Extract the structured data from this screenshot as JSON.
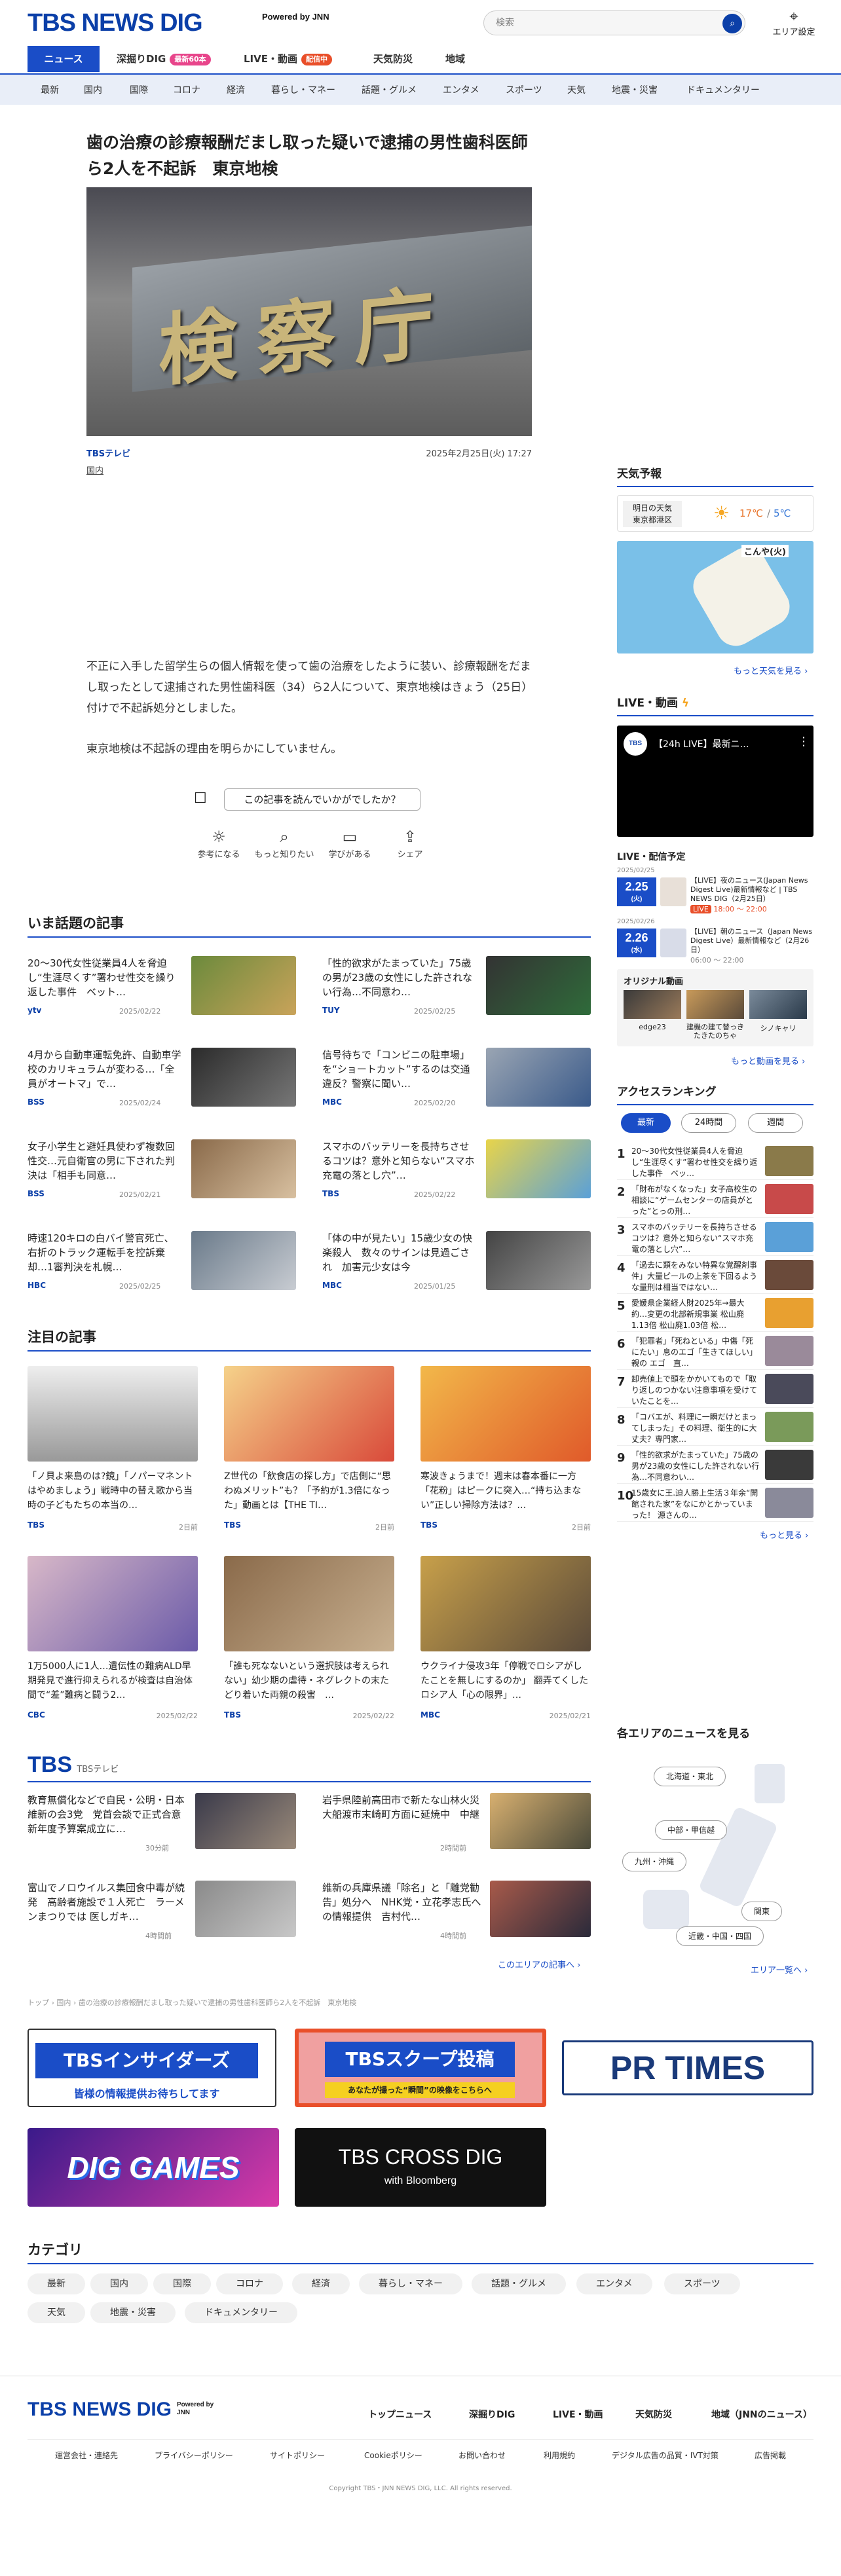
{
  "header": {
    "logo": "TBS NEWS DIG",
    "powered_by": "Powered by JNN",
    "search_placeholder": "検索",
    "area_label": "エリア設定"
  },
  "tabs": [
    {
      "label": "ニュース"
    },
    {
      "label": "深掘りDIG",
      "badge": "最新60本"
    },
    {
      "label": "LIVE・動画",
      "badge": "配信中"
    },
    {
      "label": "天気防災"
    },
    {
      "label": "地域"
    }
  ],
  "categories": [
    "最新",
    "国内",
    "国際",
    "コロナ",
    "経済",
    "暮らし・マネー",
    "話題・グルメ",
    "エンタメ",
    "スポーツ",
    "天気",
    "地震・災害",
    "ドキュメンタリー"
  ],
  "article": {
    "headline": "歯の治療の診療報酬だまし取った疑いで逮捕の男性歯科医師ら2人を不起訴　東京地検",
    "hero_text": "検察庁",
    "source": "TBSテレビ",
    "date": "2025年2月25日(火) 17:27",
    "tag": "国内",
    "body": [
      "不正に入手した留学生らの個人情報を使って歯の治療をしたように装い、診療報酬をだまし取ったとして逮捕された男性歯科医（34）ら2人について、東京地検はきょう（25日）付けで不起訴処分としました。",
      "東京地検は不起訴の理由を明らかにしていません。"
    ],
    "reaction_question": "この記事を読んでいかがでしたか？",
    "reactions": [
      {
        "icon": "lightbulb-icon",
        "label": "参考になる"
      },
      {
        "icon": "magnifier-icon",
        "label": "もっと知りたい"
      },
      {
        "icon": "book-icon",
        "label": "学びがある"
      },
      {
        "icon": "share-icon",
        "label": "シェア"
      }
    ]
  },
  "trending": {
    "title": "いま話題の記事",
    "items": [
      {
        "title": "20〜30代女性従業員4人を脅迫し“生涯尽くす”署わせ性交を繰り返した事件　ベット…",
        "source": "ytv",
        "date": "2025/02/22"
      },
      {
        "title": "「性的欲求がたまっていた」75歳の男が23歳の女性にした許されない行為…不同意わ…",
        "source": "TUY",
        "date": "2025/02/25"
      },
      {
        "title": "4月から自動車運転免許、自動車学校のカリキュラムが変わる…「全員がオートマ」で…",
        "source": "BSS",
        "date": "2025/02/24"
      },
      {
        "title": "信号待ちで「コンビニの駐車場」を“ショートカット”するのは交通違反？警察に聞い…",
        "source": "MBC",
        "date": "2025/02/20"
      },
      {
        "title": "女子小学生と避妊具使わず複数回性交…元自衛官の男に下された判決は「相手も同意…",
        "source": "BSS",
        "date": "2025/02/21"
      },
      {
        "title": "スマホのバッテリーを長持ちさせるコツは？意外と知らない“スマホ充電の落とし穴”…",
        "source": "TBS",
        "date": "2025/02/22"
      },
      {
        "title": "時速120キロの白バイ警官死亡、右折のトラック運転手を控訴棄却…1審判決を札幌…",
        "source": "HBC",
        "date": "2025/02/25"
      },
      {
        "title": "「体の中が見たい」15歳少女の快楽殺人　数々のサインは見過ごされ　加害元少女は今",
        "source": "MBC",
        "date": "2025/01/25"
      }
    ]
  },
  "featured": {
    "title": "注目の記事",
    "items": [
      {
        "title": "「ノ貝よ来島のは?鏡」「ノパーマネントはやめましょう」戦時中の替え歌から当時の子どもたちの本当の…",
        "source": "TBS",
        "date": "2日前"
      },
      {
        "title": "Z世代の「飲食店の探し方」で店側に“思わぬメリット”も？「予約が1.3倍になった」動画とは【THE TI…",
        "source": "TBS",
        "date": "2日前"
      },
      {
        "title": "寒波きょうまで！週末は春本番に一方「花粉」はピークに突入…“持ち込まない”正しい掃除方法は？…",
        "source": "TBS",
        "date": "2日前"
      },
      {
        "title": "1万5000人に1人…遺伝性の難病ALD早期発見で進行抑えられるが検査は自治体間で“差”難病と闘う2…",
        "source": "CBC",
        "date": "2025/02/22"
      },
      {
        "title": "「誰も死なないという選択肢は考えられない」幼少期の虐待・ネグレクトの末たどり着いた両親の殺害　…",
        "source": "TBS",
        "date": "2025/02/22"
      },
      {
        "title": "ウクライナ侵攻3年「停戦でロシアがしたことを無しにするのか」 翻弄てくしたロシア人「心の限界」…",
        "source": "MBC",
        "date": "2025/02/21"
      }
    ]
  },
  "tbs_block": {
    "logo": "TBS",
    "sub": "TBSテレビ",
    "items": [
      {
        "title": "教育無償化などで自民・公明・日本維新の会3党　党首会談で正式合意　新年度予算案成立に…",
        "date": "30分前"
      },
      {
        "title": "岩手県陸前高田市で新たな山林火災　大船渡市末崎町方面に延焼中　中継",
        "date": "2時間前"
      },
      {
        "title": "富山でノロウイルス集団食中毒が続発　高齢者施設で１人死亡　ラーメンまつりでは 医しガキ…",
        "date": "4時間前"
      },
      {
        "title": "維新の兵庫県議「除名」と「離党勧告」処分へ　NHK党・立花孝志氏への情報提供　吉村代…",
        "date": "4時間前"
      }
    ],
    "more": "このエリアの記事へ ›"
  },
  "breadcrumb": "トップ › 国内 › 歯の治療の診療報酬だまし取った疑いで逮捕の男性歯科医師ら2人を不起訴　東京地検",
  "sidebar": {
    "weather": {
      "title": "天気予報",
      "day": "明日の天気",
      "place": "東京都港区",
      "temp_high": "17℃",
      "temp_low": "5℃",
      "map_label": "こんや(火)",
      "more": "もっと天気を見る ›"
    },
    "live": {
      "title": "LIVE・動画",
      "video_title": "【24h LIVE】最新ニ…",
      "video_channel": "TBS NEWS DIG",
      "schedule_title": "LIVE・配信予定",
      "schedule": [
        {
          "date": "2025/02/25",
          "day": "2.25",
          "dow": "(火)",
          "title": "【LIVE】夜のニュース(Japan News Digest Live)最新情報など | TBS NEWS DIG（2月25日）",
          "time": "18:00 〜 22:00",
          "status": "LIVE"
        },
        {
          "date": "2025/02/26",
          "day": "2.26",
          "dow": "(水)",
          "title": "【LIVE】朝のニュース（Japan News Digest Live）最新情報など（2月26日）",
          "time": "06:00 〜 22:00",
          "status": ""
        }
      ],
      "original_title": "オリジナル動画",
      "originals": [
        "edge23",
        "建機の建て替っきたきたのちゃ",
        "シノキャリ"
      ],
      "more": "もっと動画を見る ›"
    },
    "ranking": {
      "title": "アクセスランキング",
      "tabs": [
        "最新",
        "24時間",
        "週間"
      ],
      "items": [
        {
          "n": "1",
          "title": "20〜30代女性従業員4人を脅迫し“生涯尽くす”署わせ性交を繰り返した事件　ベッ…"
        },
        {
          "n": "2",
          "title": "「財布がなくなった」女子高校生の相談に“ゲームセンターの店員がとった”とっの刑…"
        },
        {
          "n": "3",
          "title": "スマホのバッテリーを長持ちさせるコツは？意外と知らない“スマホ充電の落とし穴”…"
        },
        {
          "n": "4",
          "title": "「過去に類をみない特異な覚醒剤事件」大量ピールの上茶を下回るような量刑は相当ではない…"
        },
        {
          "n": "5",
          "title": "愛媛県企業経人財2025年→最大約…変更の北部新規事業 松山廃 1.13倍 松山廃1.03倍 松…"
        },
        {
          "n": "6",
          "title": "「犯罪者」「死ねといる」中傷「死にたい」息のエゴ「生きてほしい」親の エゴ　直…"
        },
        {
          "n": "7",
          "title": "卸売値上で頭をかかいてもので「取り返しのつかない注意事項を受けていたことを…"
        },
        {
          "n": "8",
          "title": "「コバエが、料理に一瞬だけとまってしまった」その料理、衛生的に大丈夫？専門家…"
        },
        {
          "n": "9",
          "title": "「性的欲求がたまっていた」75歳の男が23歳の女性にした許されない行為…不同意わい…"
        },
        {
          "n": "10",
          "title": "15歳女に王.迫人勝上生活３年余“開館された家”をなにかとかっていまった！ 源さんの…"
        }
      ],
      "more": "もっと見る ›"
    },
    "areas": {
      "title": "各エリアのニュースを見る",
      "labels": [
        "北海道・東北",
        "中部・甲信越",
        "九州・沖縄",
        "関東",
        "近畿・中国・四国"
      ],
      "more": "エリア一覧へ ›"
    }
  },
  "banners": [
    {
      "label": "TBSインサイダーズ",
      "sub": "皆様の情報提供お待ちしてます"
    },
    {
      "label": "TBSスクープ投稿",
      "sub": "あなたが撮った“瞬間”の映像をこちらへ"
    },
    {
      "label": "PR TIMES"
    },
    {
      "label": "DIG GAMES"
    },
    {
      "label": "TBS CROSS DIG",
      "sub": "with Bloomberg"
    }
  ],
  "category_section": {
    "title": "カテゴリ",
    "chips": [
      "最新",
      "国内",
      "国際",
      "コロナ",
      "経済",
      "暮らし・マネー",
      "話題・グルメ",
      "エンタメ",
      "スポーツ",
      "天気",
      "地震・災害",
      "ドキュメンタリー"
    ]
  },
  "footer": {
    "nav": [
      "トップニュース",
      "深掘りDIG",
      "LIVE・動画",
      "天気防災",
      "地域（JNNのニュース）"
    ],
    "links": [
      "運営会社・連絡先",
      "プライバシーポリシー",
      "サイトポリシー",
      "Cookieポリシー",
      "お問い合わせ",
      "利用規約",
      "デジタル広告の品質・IVT対策",
      "広告掲載"
    ],
    "copyright": "Copyright TBS・JNN NEWS DIG, LLC. All rights reserved."
  },
  "colors": {
    "brand": "#0b3fa8",
    "accent": "#1a4dc7",
    "live": "#e94f2a"
  }
}
